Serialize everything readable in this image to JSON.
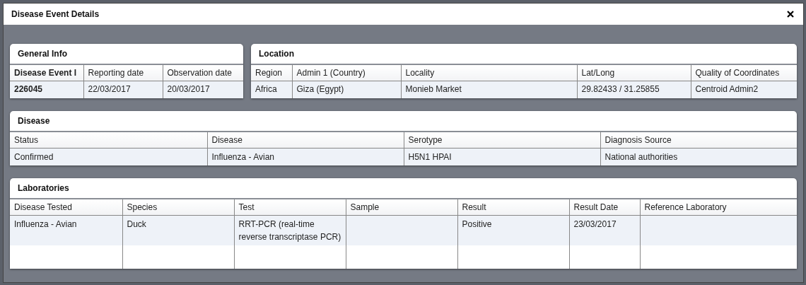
{
  "window": {
    "title": "Disease Event Details"
  },
  "general_info": {
    "title": "General Info",
    "columns": [
      "Disease Event I",
      "Reporting date",
      "Observation date"
    ],
    "rows": [
      [
        "226045",
        "22/03/2017",
        "20/03/2017"
      ]
    ]
  },
  "location": {
    "title": "Location",
    "columns": [
      "Region",
      "Admin 1 (Country)",
      "Locality",
      "Lat/Long",
      "Quality of Coordinates"
    ],
    "rows": [
      [
        "Africa",
        "Giza (Egypt)",
        "Monieb Market",
        "29.82433 / 31.25855",
        "Centroid Admin2"
      ]
    ]
  },
  "disease": {
    "title": "Disease",
    "columns": [
      "Status",
      "Disease",
      "Serotype",
      "Diagnosis Source"
    ],
    "rows": [
      [
        "Confirmed",
        "Influenza - Avian",
        "H5N1 HPAI",
        "National authorities"
      ]
    ]
  },
  "laboratories": {
    "title": "Laboratories",
    "columns": [
      "Disease Tested",
      "Species",
      "Test",
      "Sample",
      "Result",
      "Result Date",
      "Reference Laboratory"
    ],
    "rows": [
      [
        "Influenza - Avian",
        "Duck",
        "RRT-PCR (real-time reverse transcriptase PCR)",
        "",
        "Positive",
        "23/03/2017",
        ""
      ]
    ]
  }
}
